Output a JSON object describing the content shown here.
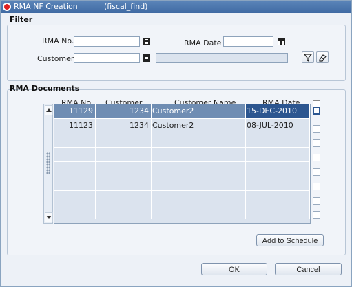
{
  "window": {
    "title": "RMA NF Creation",
    "subtitle": "(fiscal_find)"
  },
  "filter": {
    "label": "Filter",
    "rma_no_label": "RMA No.",
    "rma_no_value": "",
    "rma_date_label": "RMA Date",
    "rma_date_value": "",
    "customer_label": "Customer",
    "customer_value": "",
    "customer_name_value": ""
  },
  "documents": {
    "label": "RMA Documents",
    "columns": [
      "RMA No.",
      "Customer",
      "Customer Name",
      "RMA Date"
    ],
    "rows": [
      {
        "rma_no": "11129",
        "customer": "1234",
        "customer_name": "Customer2",
        "rma_date": "15-DEC-2010",
        "selected": true
      },
      {
        "rma_no": "11123",
        "customer": "1234",
        "customer_name": "Customer2",
        "rma_date": "08-JUL-2010",
        "selected": false
      },
      {
        "rma_no": "",
        "customer": "",
        "customer_name": "",
        "rma_date": "",
        "selected": false
      },
      {
        "rma_no": "",
        "customer": "",
        "customer_name": "",
        "rma_date": "",
        "selected": false
      },
      {
        "rma_no": "",
        "customer": "",
        "customer_name": "",
        "rma_date": "",
        "selected": false
      },
      {
        "rma_no": "",
        "customer": "",
        "customer_name": "",
        "rma_date": "",
        "selected": false
      },
      {
        "rma_no": "",
        "customer": "",
        "customer_name": "",
        "rma_date": "",
        "selected": false
      },
      {
        "rma_no": "",
        "customer": "",
        "customer_name": "",
        "rma_date": "",
        "selected": false
      }
    ],
    "add_to_schedule": "Add to Schedule"
  },
  "footer": {
    "ok": "OK",
    "cancel": "Cancel"
  },
  "icons": {
    "title": "oracle-ring-icon",
    "lov": "list-of-values-icon",
    "calendar": "calendar-icon",
    "filter": "funnel-icon",
    "clear": "eraser-icon"
  },
  "colors": {
    "title_bar": "#4a76ad",
    "selected_row": "#6f8db3",
    "selected_cell": "#2c5690"
  }
}
